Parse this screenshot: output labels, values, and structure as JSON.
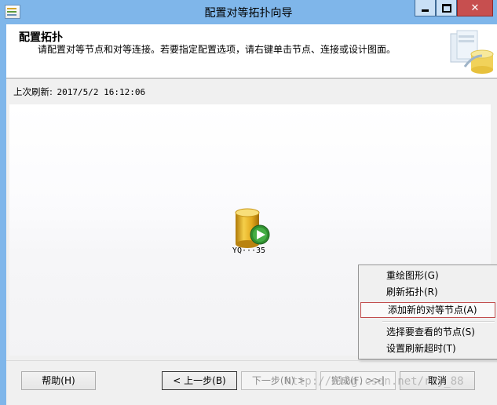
{
  "window": {
    "title": "配置对等拓扑向导",
    "minimize_icon": "minimize-icon",
    "maximize_icon": "maximize-icon",
    "close_icon": "close-icon",
    "close_glyph": "✕"
  },
  "header": {
    "title": "配置拓扑",
    "description": "请配置对等节点和对等连接。若要指定配置选项，请右键单击节点、连接或设计图面。"
  },
  "refresh": {
    "label": "上次刷新:",
    "timestamp": "2017/5/2 16:12:06"
  },
  "node": {
    "label": "YQ···35",
    "icon": "database-play-icon"
  },
  "context_menu": {
    "items": [
      {
        "label": "重绘图形(G)"
      },
      {
        "label": "刷新拓扑(R)"
      },
      {
        "label": "添加新的对等节点(A)"
      },
      {
        "label": "选择要查看的节点(S)"
      },
      {
        "label": "设置刷新超时(T)"
      }
    ]
  },
  "buttons": {
    "help": "帮助(H)",
    "back": "< 上一步(B)",
    "next": "下一步(N) >",
    "finish": "完成(F) >>|",
    "cancel": "取消"
  },
  "watermark": "http://blog.csdn.net/rey_88",
  "colors": {
    "titlebar": "#7fb6ea",
    "close_button": "#c74f4f",
    "highlight_border": "#c14d4d",
    "node_cylinder": "#e0a91c",
    "play_badge": "#2f8f2f"
  }
}
